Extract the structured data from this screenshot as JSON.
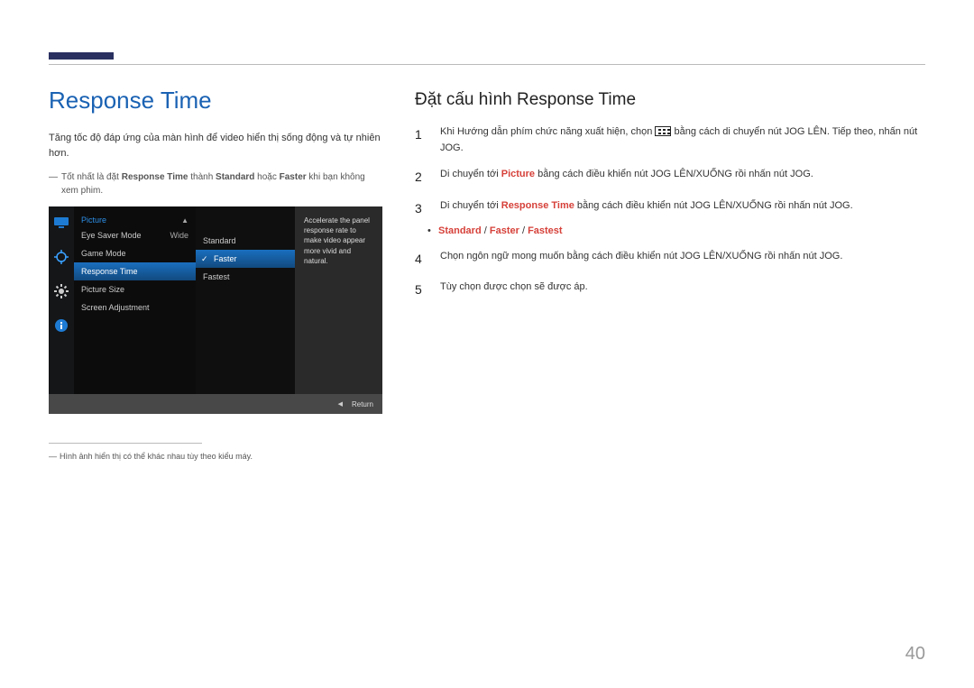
{
  "header": {},
  "left": {
    "title": "Response Time",
    "intro": "Tăng tốc độ đáp ứng của màn hình để video hiển thị sống động và tự nhiên hơn.",
    "tip_prefix": "Tốt nhất là đặt ",
    "tip_bold1": "Response Time",
    "tip_mid": " thành ",
    "tip_bold2": "Standard",
    "tip_or": " hoặc ",
    "tip_bold3": "Faster",
    "tip_suffix": " khi bạn không xem phim.",
    "footnote": "Hình ảnh hiển thị có thể khác nhau tùy theo kiểu máy."
  },
  "osd": {
    "menu_title": "Picture",
    "items": [
      {
        "label": "Eye Saver Mode",
        "value": "",
        "value2": "Wide"
      },
      {
        "label": "Game Mode",
        "value": ""
      },
      {
        "label": "Response Time",
        "value": "",
        "selected": true
      },
      {
        "label": "Picture Size",
        "value": ""
      },
      {
        "label": "Screen Adjustment",
        "value": ""
      }
    ],
    "sub": [
      {
        "label": "Standard"
      },
      {
        "label": "Faster",
        "selected": true
      },
      {
        "label": "Fastest"
      }
    ],
    "tip": "Accelerate the panel response rate to make video appear more vivid and natural.",
    "return_label": "Return"
  },
  "right": {
    "heading": "Đặt cấu hình Response Time",
    "steps": {
      "1": {
        "pre": "Khi Hướng dẫn phím chức năng xuất hiện, chọn ",
        "post": " bằng cách di chuyển nút JOG LÊN. Tiếp theo, nhấn nút JOG."
      },
      "2": {
        "pre": "Di chuyển tới ",
        "red": "Picture",
        "post": " bằng cách điều khiển nút JOG LÊN/XUỐNG rồi nhấn nút JOG."
      },
      "3": {
        "pre": "Di chuyển tới ",
        "red": "Response Time",
        "post": " bằng cách điều khiển nút JOG LÊN/XUỐNG rồi nhấn nút JOG."
      },
      "4": "Chọn ngôn ngữ mong muốn bằng cách điều khiển nút JOG LÊN/XUỐNG rồi nhấn nút JOG.",
      "5": "Tùy chọn được chọn sẽ được áp."
    },
    "options": {
      "a": "Standard",
      "sep": " / ",
      "b": "Faster",
      "c": "Fastest"
    }
  },
  "page_number": "40"
}
